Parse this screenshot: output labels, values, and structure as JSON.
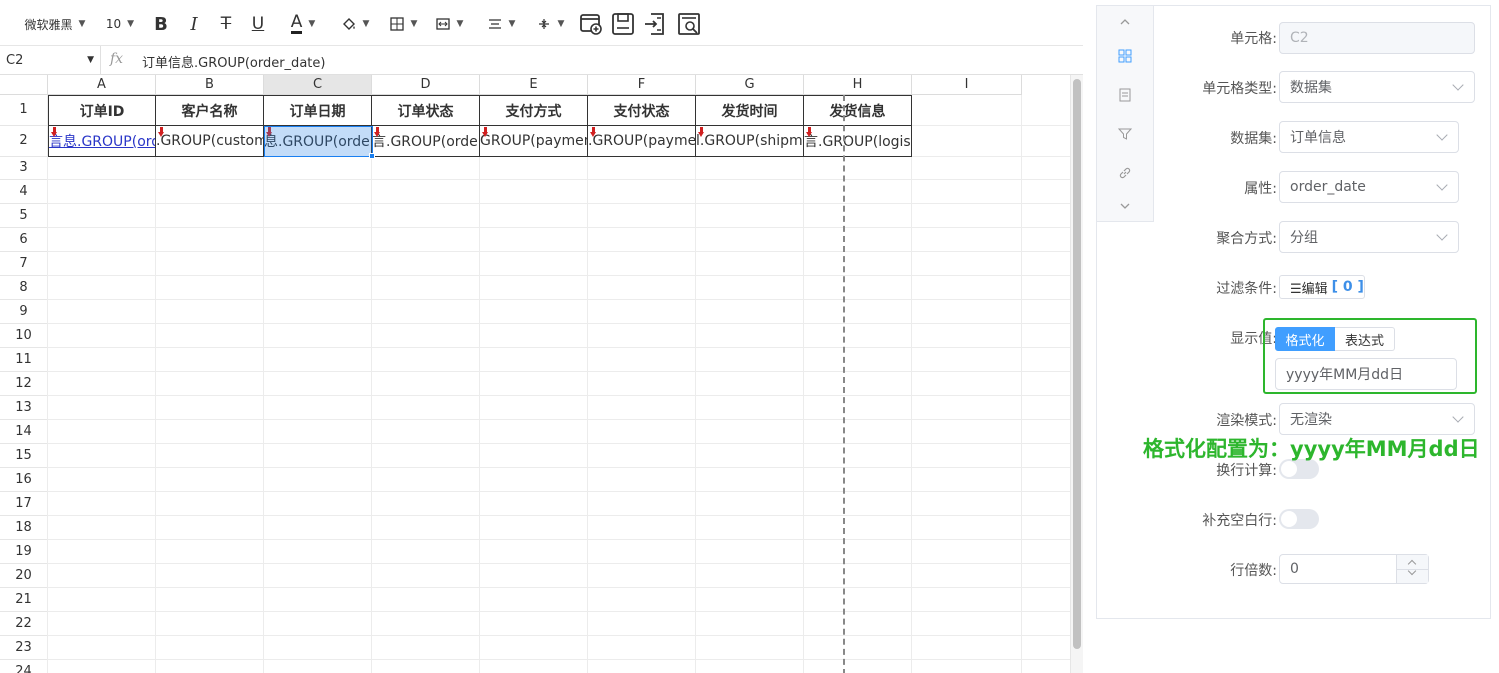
{
  "toolbar": {
    "font_family": "微软雅黑",
    "font_size": "10",
    "bold": "B",
    "italic": "I",
    "strike": "T",
    "underline": "U",
    "font_color": "A"
  },
  "formula_bar": {
    "name_box": "C2",
    "fx": "fx",
    "formula": "订单信息.GROUP(order_date)"
  },
  "grid": {
    "columns": [
      "A",
      "B",
      "C",
      "D",
      "E",
      "F",
      "G",
      "H",
      "I"
    ],
    "selected_column": "C",
    "rows": [
      "1",
      "2",
      "3",
      "4",
      "5",
      "6",
      "7",
      "8",
      "9",
      "10",
      "11",
      "12",
      "13",
      "14",
      "15",
      "16",
      "17",
      "18",
      "19",
      "20",
      "21",
      "22",
      "23",
      "24"
    ],
    "header_cells": [
      "订单ID",
      "客户名称",
      "订单日期",
      "订单状态",
      "支付方式",
      "支付状态",
      "发货时间",
      "发货信息"
    ],
    "data_cells": [
      "言息.GROUP(orde",
      ".GROUP(custome",
      "息.GROUP(order",
      "言.GROUP(order_",
      "GROUP(payment_",
      ".GROUP(paymen",
      "l.GROUP(shipme",
      "言.GROUP(logistic"
    ],
    "selected_cell": "C2"
  },
  "panel": {
    "cell_label": "单元格:",
    "cell_value": "C2",
    "cell_type_label": "单元格类型:",
    "cell_type_value": "数据集",
    "dataset_label": "数据集:",
    "dataset_value": "订单信息",
    "attr_label": "属性:",
    "attr_value": "order_date",
    "agg_label": "聚合方式:",
    "agg_value": "分组",
    "filter_label": "过滤条件:",
    "filter_btn": "☰编辑",
    "filter_count": "[ 0 ]",
    "display_label": "显示值:",
    "display_tab_format": "格式化",
    "display_tab_expr": "表达式",
    "display_format_value": "yyyy年MM月dd日",
    "render_label": "渲染模式:",
    "render_value": "无渲染",
    "wrap_label": "换行计算:",
    "fill_label": "补充空白行:",
    "multiple_label": "行倍数:",
    "multiple_value": "0"
  },
  "annotation": "格式化配置为：yyyy年MM月dd日",
  "colors": {
    "accent": "#409eff",
    "annotation": "#2db62d",
    "selection": "#1a7ff0",
    "arrow": "#d02020"
  }
}
